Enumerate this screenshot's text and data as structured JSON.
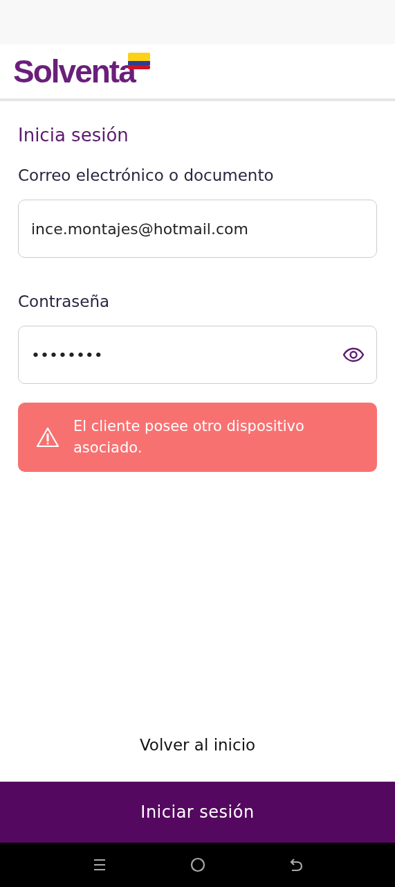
{
  "header": {
    "logo": "Solventa"
  },
  "form": {
    "title": "Inicia sesión",
    "fields": [
      {
        "kind": "text",
        "label": "Correo electrónico o documento",
        "value": "ince.montajes@hotmail.com"
      },
      {
        "kind": "password",
        "label": "Contraseña",
        "value": "••••••••"
      }
    ],
    "error": "El cliente posee otro dispositivo asociado."
  },
  "back_link": "Volver al inicio",
  "submit_button": "Iniciar sesión"
}
